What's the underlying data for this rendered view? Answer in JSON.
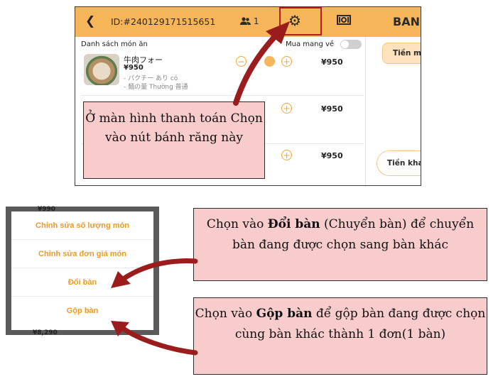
{
  "app": {
    "back_icon": "chevron-left-icon",
    "order_id": "ID:#240129171515651",
    "people_count": "1",
    "gear_icon": "gear-icon",
    "money_icon": "cash-icon",
    "title_partial": "BAN",
    "list_header": "Danh sách món ăn",
    "takeaway_label": "Mua mang về",
    "item": {
      "name": "牛肉フォー",
      "price": "¥950",
      "option1": "- パクチー あり có",
      "option2": "- 麺の量 Thường 普通"
    },
    "row_prices": [
      "¥950",
      "¥950",
      "¥950"
    ],
    "minus_symbol": "−",
    "plus_symbol": "+",
    "tien_ma_label": "Tiền ma",
    "tien_kha_label": "Tiền kha"
  },
  "callout_top": "Ở màn hình thanh toán Chọn vào nút bánh răng này",
  "menu": {
    "peek_top": "¥990",
    "peek_bottom": "¥8,290",
    "items": [
      "Chỉnh sửa số lượng món",
      "Chỉnh sửa đơn giá món",
      "Đổi bàn",
      "Gộp bàn"
    ]
  },
  "callout_doi": {
    "pre": "Chọn vào ",
    "bold": "Đổi bàn",
    "post": " (Chuyển bàn) để chuyển bàn đang được chọn sang bàn khác"
  },
  "callout_gop": {
    "pre": "Chọn vào ",
    "bold": "Gộp bàn",
    "post": " để gộp bàn đang được chọn cùng bàn khác thành 1 đơn(1 bàn)"
  },
  "colors": {
    "accent": "#f7b55a",
    "menu_text": "#ef9a23",
    "callout_bg": "#f9cccc",
    "arrow": "#9b1c1c"
  }
}
